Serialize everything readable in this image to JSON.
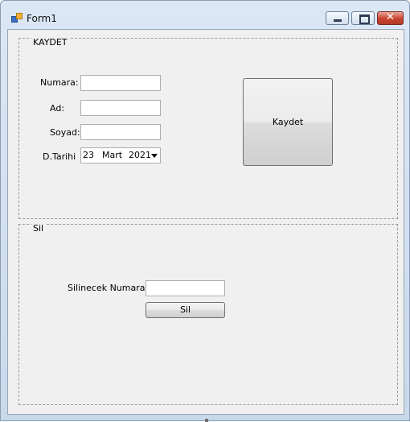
{
  "window": {
    "title": "Form1",
    "icons": {
      "app": "form-app-icon",
      "minimize": "minimize-icon",
      "maximize": "maximize-icon",
      "close": "close-icon"
    }
  },
  "kaydet_group": {
    "title": "KAYDET",
    "numara_label": "Numara:",
    "ad_label": "Ad:",
    "soyad_label": "Soyad:",
    "dtarihi_label": "D.Tarihi",
    "date": {
      "day": "23",
      "month": "Mart",
      "year": "2021"
    },
    "numara_value": "",
    "ad_value": "",
    "soyad_value": "",
    "kaydet_button": "Kaydet"
  },
  "sil_group": {
    "title": "Sil",
    "silinecek_label": "Silinecek Numara:",
    "silinecek_value": "",
    "sil_button": "Sil"
  }
}
